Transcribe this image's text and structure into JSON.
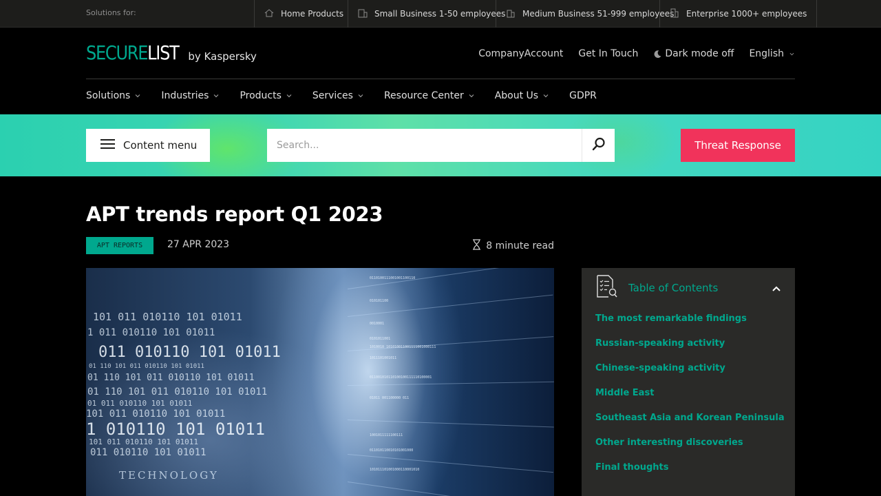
{
  "topbar": {
    "label": "Solutions for:",
    "segments": [
      {
        "label": "Home Products",
        "icon": "home-icon"
      },
      {
        "label": "Small Business 1-50 employees",
        "icon": "building-small-icon"
      },
      {
        "label": "Medium Business 51-999 employees",
        "icon": "building-medium-icon"
      },
      {
        "label": "Enterprise 1000+ employees",
        "icon": "building-large-icon"
      }
    ]
  },
  "header": {
    "logo_part1": "SECURE",
    "logo_part2": "LIST",
    "logo_by": "by Kaspersky",
    "links": {
      "company_account": "CompanyAccount",
      "get_in_touch": "Get In Touch",
      "dark_mode": "Dark mode off",
      "language": "English"
    }
  },
  "nav": {
    "items": [
      {
        "label": "Solutions"
      },
      {
        "label": "Industries"
      },
      {
        "label": "Products"
      },
      {
        "label": "Services"
      },
      {
        "label": "Resource Center"
      },
      {
        "label": "About Us"
      },
      {
        "label": "GDPR"
      }
    ]
  },
  "toolbar": {
    "content_menu": "Content menu",
    "search_placeholder": "Search...",
    "threat_response": "Threat Response"
  },
  "article": {
    "title": "APT trends report Q1 2023",
    "tag": "APT REPORTS",
    "date": "27 APR 2023",
    "read_time": "8 minute read",
    "hero_caption": "TECHNOLOGY"
  },
  "toc": {
    "title": "Table of Contents",
    "items": [
      "The most remarkable findings",
      "Russian-speaking activity",
      "Chinese-speaking activity",
      "Middle East",
      "Southeast Asia and Korean Peninsula",
      "Other interesting discoveries",
      "Final thoughts"
    ]
  },
  "colors": {
    "brand_green": "#00a88e",
    "threat_red": "#f1335b",
    "band_teal": "#35d3c2"
  }
}
